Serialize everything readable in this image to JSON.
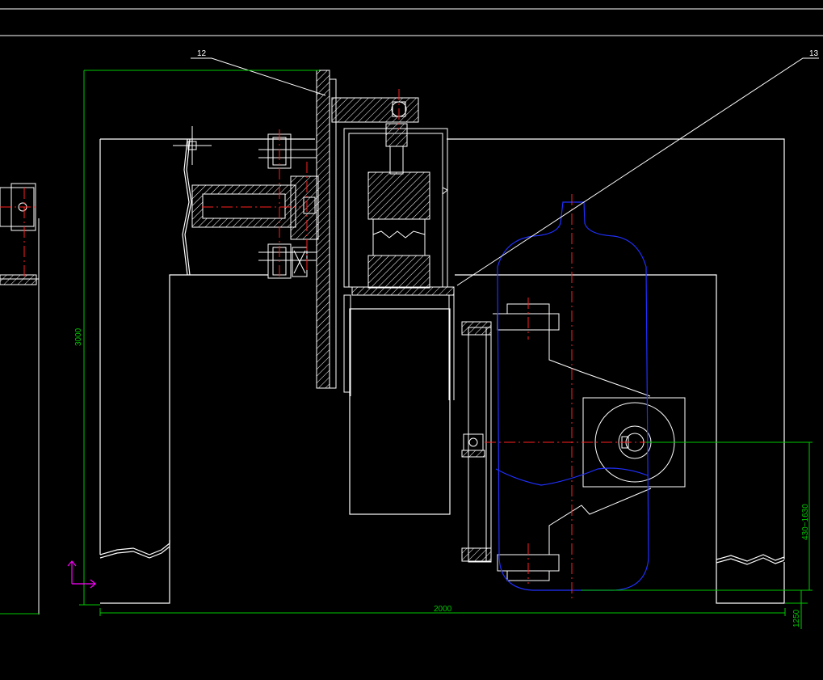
{
  "drawing": {
    "leaders": {
      "part_a": "12",
      "part_b": "13"
    },
    "dimensions": {
      "height_total": "3000",
      "width_total": "2000",
      "right_range": "430~1630",
      "right_bottom": "1250"
    }
  },
  "colors": {
    "background": "#000000",
    "outline": "#ffffff",
    "dimension": "#00c800",
    "centerline": "#ff2020",
    "bottle": "#2030ff",
    "ucs": "#ff00ff"
  }
}
